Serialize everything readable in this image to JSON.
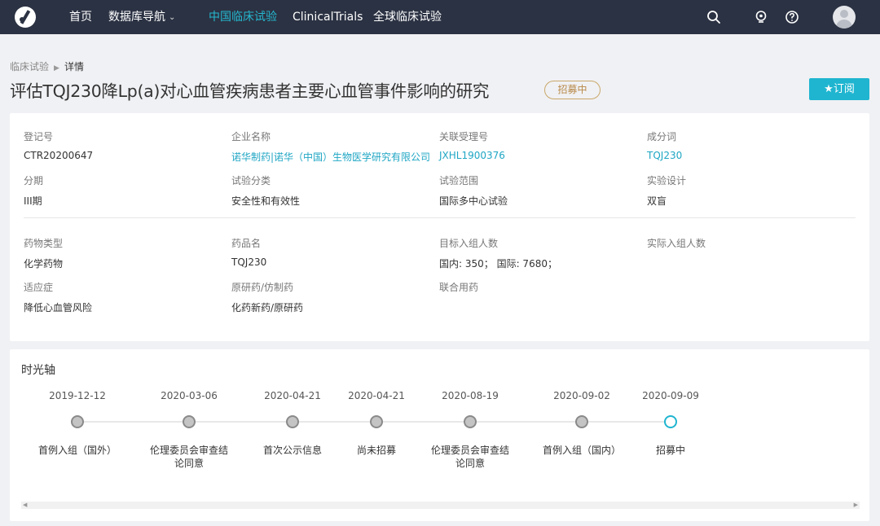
{
  "nav": {
    "items": [
      {
        "label": "首页"
      },
      {
        "label": "数据库导航"
      },
      {
        "label": "中国临床试验"
      },
      {
        "label": "ClinicalTrials"
      },
      {
        "label": "全球临床试验"
      }
    ],
    "active_color": "#25b8cf",
    "bg_color": "#2b3243"
  },
  "breadcrumb": {
    "parent": "临床试验",
    "current": "详情"
  },
  "title": "评估TQJ230降Lp(a)对心血管疾病患者主要心血管事件影响的研究",
  "status": "招募中",
  "subscribe_label": "★订阅",
  "info": {
    "reg_no": {
      "label": "登记号",
      "value": "CTR20200647"
    },
    "company": {
      "label": "企业名称",
      "value": "诺华制药|诺华（中国）生物医学研究有限公司"
    },
    "accept_no": {
      "label": "关联受理号",
      "value": "JXHL1900376"
    },
    "ingredient": {
      "label": "成分词",
      "value": "TQJ230"
    },
    "phase": {
      "label": "分期",
      "value": "III期"
    },
    "category": {
      "label": "试验分类",
      "value": "安全性和有效性"
    },
    "scope": {
      "label": "试验范围",
      "value": "国际多中心试验"
    },
    "design": {
      "label": "实验设计",
      "value": "双盲"
    },
    "drug_type": {
      "label": "药物类型",
      "value": "化学药物"
    },
    "drug_name": {
      "label": "药品名",
      "value": "TQJ230"
    },
    "target_enroll": {
      "label": "目标入组人数",
      "value": "国内: 350； 国际: 7680；"
    },
    "actual_enroll": {
      "label": "实际入组人数",
      "value": ""
    },
    "indication": {
      "label": "适应症",
      "value": "降低心血管风险"
    },
    "original": {
      "label": "原研药/仿制药",
      "value": "化药新药/原研药"
    },
    "combo": {
      "label": "联合用药",
      "value": ""
    }
  },
  "timeline": {
    "title": "时光轴",
    "events": [
      {
        "date": "2019-12-12",
        "label": "首例入组（国外）"
      },
      {
        "date": "2020-03-06",
        "label": "伦理委员会审查结论同意"
      },
      {
        "date": "2020-04-21",
        "label": "首次公示信息"
      },
      {
        "date": "2020-04-21",
        "label": "尚未招募"
      },
      {
        "date": "2020-08-19",
        "label": "伦理委员会审查结论同意"
      },
      {
        "date": "2020-09-02",
        "label": "首例入组（国内）"
      },
      {
        "date": "2020-09-09",
        "label": "招募中"
      }
    ],
    "current_color": "#1fb5d0"
  },
  "icons": {
    "logo": "logo-icon",
    "search": "search-icon",
    "lightbulb": "lightbulb-icon",
    "help": "help-icon",
    "avatar": "avatar-icon"
  }
}
